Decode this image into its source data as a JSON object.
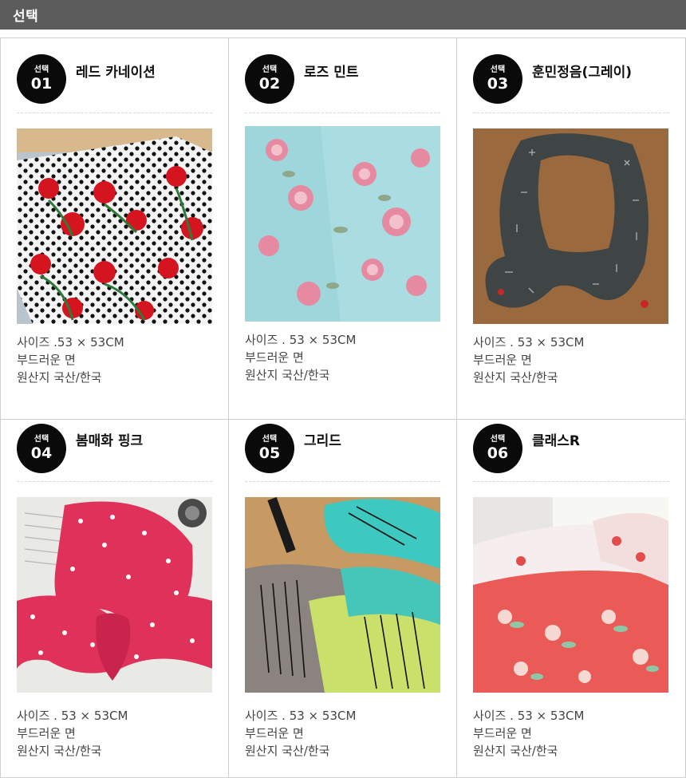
{
  "header": {
    "title": "선택"
  },
  "badge_label": "선택",
  "items": [
    {
      "num": "01",
      "name": "레드 카네이션",
      "size": "사이즈 .53 × 53CM",
      "material": "부드러운 면",
      "origin": "원산지 국산/한국"
    },
    {
      "num": "02",
      "name": "로즈 민트",
      "size": "사이즈 . 53 × 53CM",
      "material": "부드러운 면",
      "origin": "원산지 국산/한국"
    },
    {
      "num": "03",
      "name": "훈민정음(그레이)",
      "size": "사이즈 . 53 × 53CM",
      "material": "부드러운 면",
      "origin": "원산지 국산/한국"
    },
    {
      "num": "04",
      "name": "봄매화 핑크",
      "size": "사이즈 . 53 × 53CM",
      "material": "부드러운 면",
      "origin": "원산지 국산/한국"
    },
    {
      "num": "05",
      "name": "그리드",
      "size": "사이즈 . 53 × 53CM",
      "material": "부드러운 면",
      "origin": "원산지 국산/한국"
    },
    {
      "num": "06",
      "name": "클래스R",
      "size": "사이즈 . 53 × 53CM",
      "material": "부드러운 면",
      "origin": "원산지 국산/한국"
    }
  ]
}
